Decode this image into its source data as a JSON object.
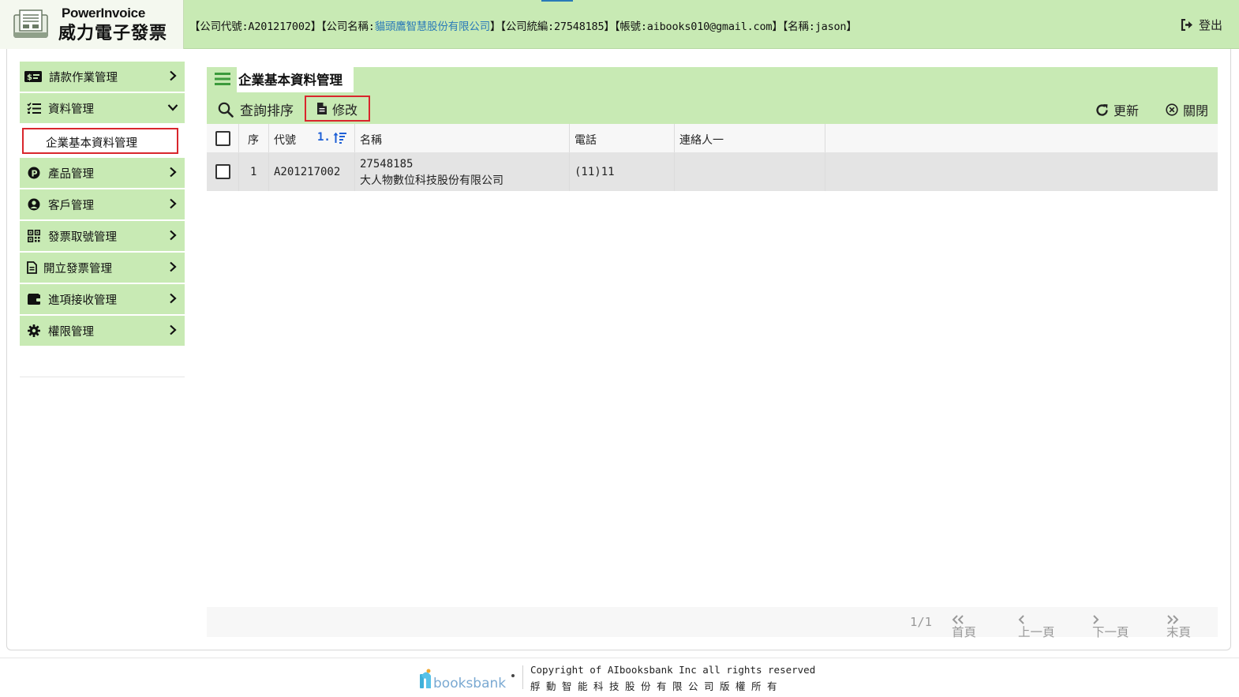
{
  "header": {
    "logo_en": "PowerInvoice",
    "logo_zh": "威力電子發票",
    "info_prefix": "【公司代號:A201217002】【公司名稱:",
    "company_name": "貓頭鷹智慧股份有限公司",
    "info_suffix": "】【公司統編:27548185】【帳號:aibooks010@gmail.com】【名稱:jason】",
    "logout_label": "登出"
  },
  "sidebar": {
    "items": [
      {
        "label": "請款作業管理",
        "icon": "invoice-dollar-icon",
        "expanded": false
      },
      {
        "label": "資料管理",
        "icon": "list-check-icon",
        "expanded": true
      },
      {
        "label": "產品管理",
        "icon": "product-p-icon",
        "expanded": false
      },
      {
        "label": "客戶管理",
        "icon": "user-circle-icon",
        "expanded": false
      },
      {
        "label": "發票取號管理",
        "icon": "qr-code-icon",
        "expanded": false
      },
      {
        "label": "開立發票管理",
        "icon": "file-icon",
        "expanded": false
      },
      {
        "label": "進項接收管理",
        "icon": "wallet-icon",
        "expanded": false
      },
      {
        "label": "權限管理",
        "icon": "gear-icon",
        "expanded": false
      }
    ],
    "sub_item": "企業基本資料管理"
  },
  "content": {
    "title": "企業基本資料管理",
    "toolbar": {
      "query_label": "查詢排序",
      "edit_label": "修改",
      "refresh_label": "更新",
      "close_label": "關閉"
    },
    "table": {
      "headers": {
        "seq": "序",
        "code": "代號",
        "sort": "1.",
        "name": "名稱",
        "phone": "電話",
        "contact": "連絡人一"
      },
      "rows": [
        {
          "seq": "1",
          "code": "A201217002",
          "tax_id": "27548185",
          "name": "大人物數位科技股份有限公司",
          "phone": "(11)11",
          "contact": ""
        }
      ]
    },
    "pager": {
      "page": "1/1",
      "first": "首頁",
      "prev": "上一頁",
      "next": "下一頁",
      "last": "末頁"
    }
  },
  "footer": {
    "brand": "booksbank",
    "copyright": "Copyright of AIbooksbank Inc all rights reserved",
    "company_cn": "艀動智能科技股份有限公司版權所有"
  },
  "colors": {
    "accent_green": "#c8eab4",
    "highlight_red": "#d9262c",
    "link_blue": "#2a7ab8",
    "sort_blue": "#1d5fd6"
  }
}
